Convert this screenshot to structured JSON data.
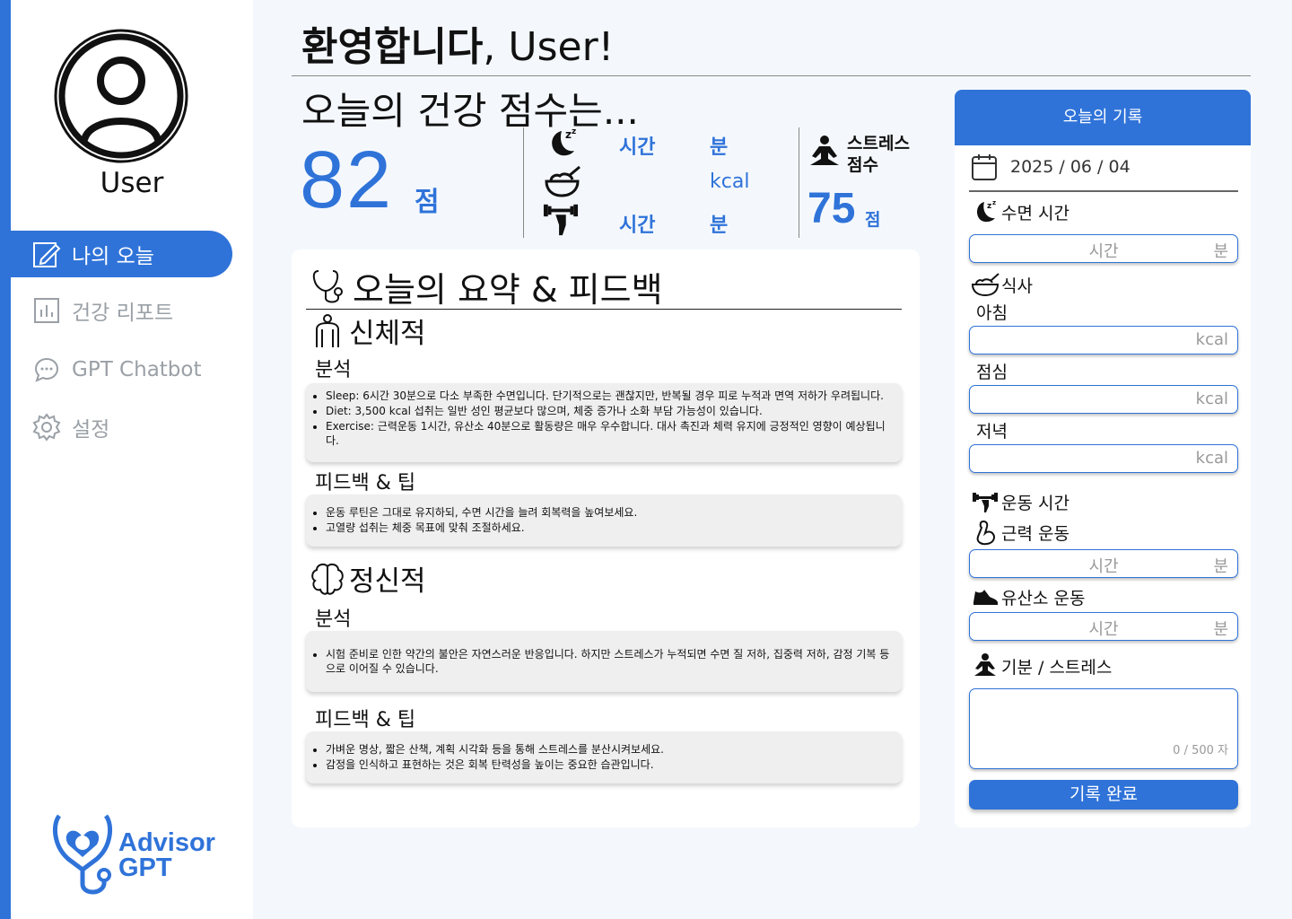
{
  "sidebar": {
    "username": "User",
    "nav": [
      {
        "label": "나의 오늘",
        "icon": "edit-icon",
        "active": true
      },
      {
        "label": "건강 리포트",
        "icon": "report-chart-icon",
        "active": false
      },
      {
        "label": "GPT Chatbot",
        "icon": "chat-bubble-icon",
        "active": false
      },
      {
        "label": "설정",
        "icon": "gear-icon",
        "active": false
      }
    ],
    "logo": {
      "line1": "Advisor",
      "line2": "GPT"
    }
  },
  "header": {
    "welcome": "환영합니다",
    "welcome_user": ", User!"
  },
  "score": {
    "title": "오늘의 건강 점수는...",
    "value": "82",
    "unit": "점",
    "sleep": {
      "hours_label": "시간",
      "minutes_label": "분"
    },
    "diet": {
      "kcal_label": "kcal"
    },
    "exercise": {
      "hours_label": "시간",
      "minutes_label": "분"
    },
    "stress": {
      "label_line1": "스트레스",
      "label_line2": "점수",
      "value": "75",
      "unit": "점"
    }
  },
  "summary": {
    "title": "오늘의 요약 & 피드백",
    "physical": {
      "title": "신체적",
      "analysis_title": "분석",
      "analysis": [
        "Sleep: 6시간 30분으로 다소 부족한 수면입니다. 단기적으로는 괜찮지만, 반복될 경우 피로 누적과 면역 저하가 우려됩니다.",
        "Diet: 3,500 kcal 섭취는 일반 성인 평균보다 많으며, 체중 증가나 소화 부담 가능성이 있습니다.",
        "Exercise: 근력운동 1시간, 유산소 40분으로 활동량은 매우 우수합니다. 대사 촉진과 체력 유지에 긍정적인 영향이 예상됩니다."
      ],
      "feedback_title": "피드백 & 팁",
      "feedback": [
        "운동 루틴은 그대로 유지하되, 수면 시간을 늘려 회복력을 높여보세요.",
        "고열량 섭취는 체중 목표에 맞춰 조절하세요."
      ]
    },
    "mental": {
      "title": "정신적",
      "analysis_title": "분석",
      "analysis": [
        "시험 준비로 인한 약간의 불안은 자연스러운 반응입니다. 하지만 스트레스가 누적되면 수면 질 저하, 집중력 저하, 감정 기복 등으로 이어질 수 있습니다."
      ],
      "feedback_title": "피드백 & 팁",
      "feedback": [
        "가벼운 명상, 짧은 산책, 계획 시각화 등을 통해 스트레스를 분산시켜보세요.",
        "감정을 인식하고 표현하는 것은 회복 탄력성을 높이는 중요한 습관입니다."
      ]
    }
  },
  "record": {
    "title": "오늘의 기록",
    "date": "2025 / 06 / 04",
    "sleep_label": "수면 시간",
    "sleep_placeholder": "시간",
    "sleep_unit": "분",
    "meal_label": "식사",
    "breakfast": "아침",
    "lunch": "점심",
    "dinner": "저녁",
    "kcal": "kcal",
    "exercise_label": "운동 시간",
    "strength_label": "근력 운동",
    "cardio_label": "유산소 운동",
    "time_placeholder": "시간",
    "minute_unit": "분",
    "mood_label": "기분 / 스트레스",
    "char_count": "0 / 500 자",
    "submit": "기록 완료"
  },
  "colors": {
    "accent": "#2f73d9",
    "background": "#f4f8fd"
  }
}
